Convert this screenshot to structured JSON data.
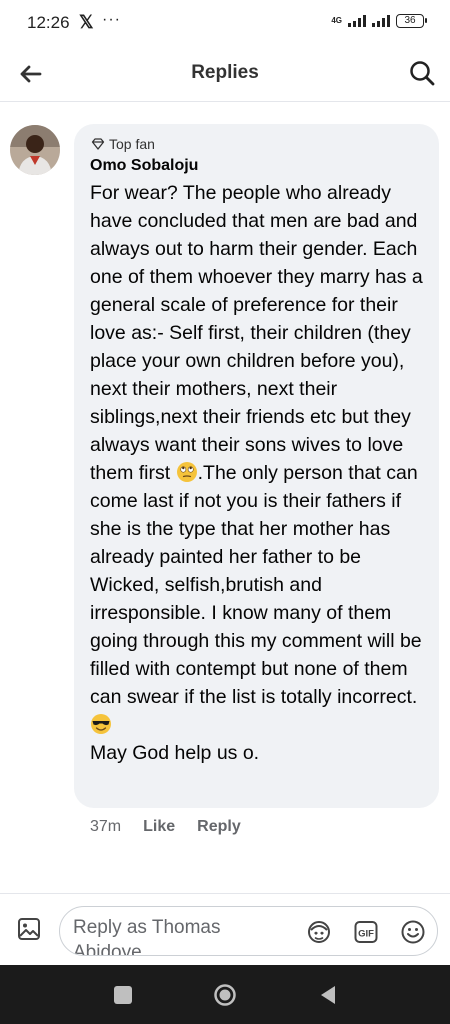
{
  "status_bar": {
    "time": "12:26",
    "x_glyph": "𝕏",
    "more": "···",
    "network": "4G",
    "battery": "36"
  },
  "header": {
    "title": "Replies",
    "back_icon": "arrow-left-icon",
    "search_icon": "search-icon"
  },
  "comment": {
    "badge": "Top fan",
    "author": "Omo Sobaloju",
    "text_part1": "For wear? The people who already have concluded that men are bad and always out to harm their gender. Each one of them whoever they marry has a general scale of preference for their love as:- Self first, their children (they place your own children before you), next their mothers, next their siblings,next their friends etc but they always want their sons wives to love them first ",
    "text_part2": ".The only person that can come last if not you is their fathers if she is the type that her mother has already painted her father to be Wicked, selfish,brutish and irresponsible. I know many of them going through this my comment will be filled with contempt but none of them can swear if the list is totally incorrect.",
    "text_part3": "\nMay God help us o.",
    "time_ago": "37m",
    "like_label": "Like",
    "reply_label": "Reply"
  },
  "composer": {
    "placeholder": "Reply as Thomas Abidoye",
    "gif_label": "GIF"
  },
  "colors": {
    "bubble": "#f0f2f5",
    "meta_text": "#65676b",
    "navbar": "#1b1b1b"
  }
}
